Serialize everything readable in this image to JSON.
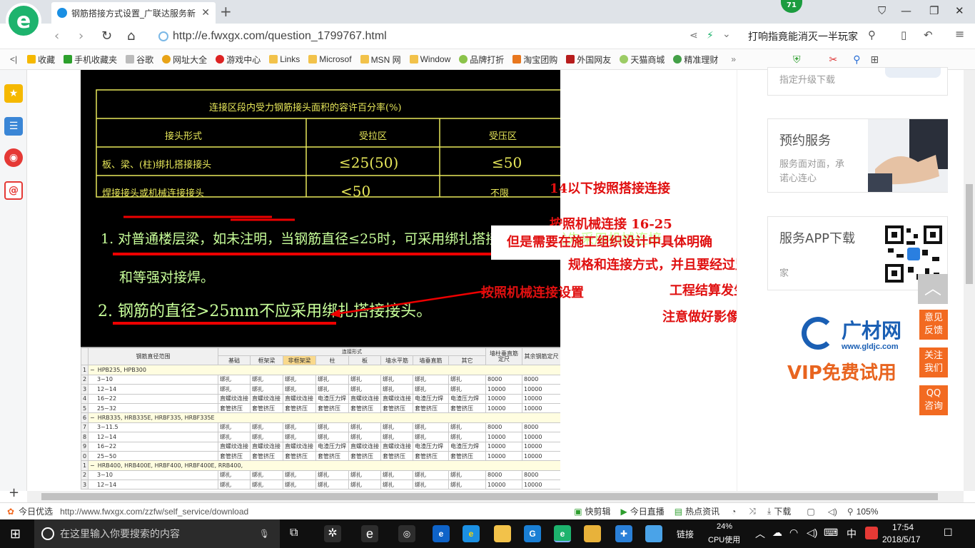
{
  "browser": {
    "tab_title": "钢筋搭接方式设置_广联达服务新",
    "badge": "71",
    "url": "http://e.fwxgx.com/question_1799767.html",
    "search_text": "打响指竟能消灭一半玩家",
    "ie_logo": "e"
  },
  "bookmarks": [
    "收藏",
    "手机收藏夹",
    "谷歌",
    "网址大全",
    "游戏中心",
    "Links",
    "Microsof",
    "MSN 网",
    "Window",
    "品牌打折",
    "淘宝团购",
    "外国网友",
    "天猫商城",
    "精准理财"
  ],
  "cad": {
    "table_title": "连接区段内受力钢筋接头面积的容许百分率(%)",
    "headers": [
      "接头形式",
      "受拉区",
      "受压区"
    ],
    "rows": [
      [
        "板、梁、(柱)绑扎搭接接头",
        "≤25(50)",
        "≤50"
      ],
      [
        "焊接接头或机械连接接头",
        "<50",
        "不限"
      ]
    ],
    "note1a": "1. 对普通楼层梁，如未注明，当钢筋直径≤25时，可采用绑扎搭接，但建议优先采用机械连接",
    "note1b": "和等强对接焊。",
    "note2": "2. 钢筋的直径>25mm不应采用绑扎搭接接头。"
  },
  "annotations": {
    "a1": "14以下按照搭接连接",
    "a2": "按照机械连接 16-25",
    "a3": "但是需要在施工组织设计中具体明确",
    "a4": "规格和连接方式，并且要经过监理签字，避免",
    "a5": "按照机械连接设置",
    "a6": "工程结算发生不必要的麻烦",
    "a7": "注意做好影像资料"
  },
  "sheet": {
    "top_group": "连接形式",
    "headers": [
      "钢筋直径范围",
      "基础",
      "框架梁",
      "非框架梁",
      "柱",
      "板",
      "墙水平筋",
      "墙垂直筋",
      "其它",
      "墙柱垂直筋定尺",
      "其余钢筋定尺"
    ],
    "rows": [
      {
        "n": "1",
        "exp": "−",
        "label": "HPB235, HPB300",
        "cells": [],
        "grp": true
      },
      {
        "n": "2",
        "exp": "",
        "label": "3~10",
        "cells": [
          "绑扎",
          "绑扎",
          "绑扎",
          "绑扎",
          "绑扎",
          "绑扎",
          "绑扎",
          "绑扎",
          "8000",
          "8000"
        ]
      },
      {
        "n": "3",
        "exp": "",
        "label": "12~14",
        "cells": [
          "绑扎",
          "绑扎",
          "绑扎",
          "绑扎",
          "绑扎",
          "绑扎",
          "绑扎",
          "绑扎",
          "10000",
          "10000"
        ]
      },
      {
        "n": "4",
        "exp": "",
        "label": "16~22",
        "cells": [
          "直螺纹连接",
          "直螺纹连接",
          "直螺纹连接",
          "电渣压力焊",
          "直螺纹连接",
          "直螺纹连接",
          "电渣压力焊",
          "电渣压力焊",
          "10000",
          "10000"
        ]
      },
      {
        "n": "5",
        "exp": "",
        "label": "25~32",
        "cells": [
          "套管挤压",
          "套管挤压",
          "套管挤压",
          "套管挤压",
          "套管挤压",
          "套管挤压",
          "套管挤压",
          "套管挤压",
          "10000",
          "10000"
        ]
      },
      {
        "n": "6",
        "exp": "−",
        "label": "HRB335, HRB335E, HRBF335, HRBF335E",
        "cells": [],
        "grp": true
      },
      {
        "n": "7",
        "exp": "",
        "label": "3~11.5",
        "cells": [
          "绑扎",
          "绑扎",
          "绑扎",
          "绑扎",
          "绑扎",
          "绑扎",
          "绑扎",
          "绑扎",
          "8000",
          "8000"
        ]
      },
      {
        "n": "8",
        "exp": "",
        "label": "12~14",
        "cells": [
          "绑扎",
          "绑扎",
          "绑扎",
          "绑扎",
          "绑扎",
          "绑扎",
          "绑扎",
          "绑扎",
          "10000",
          "10000"
        ]
      },
      {
        "n": "9",
        "exp": "",
        "label": "16~22",
        "cells": [
          "直螺纹连接",
          "直螺纹连接",
          "直螺纹连接",
          "电渣压力焊",
          "直螺纹连接",
          "直螺纹连接",
          "电渣压力焊",
          "电渣压力焊",
          "10000",
          "10000"
        ]
      },
      {
        "n": "0",
        "exp": "",
        "label": "25~50",
        "cells": [
          "套管挤压",
          "套管挤压",
          "套管挤压",
          "套管挤压",
          "套管挤压",
          "套管挤压",
          "套管挤压",
          "套管挤压",
          "10000",
          "10000"
        ]
      },
      {
        "n": "1",
        "exp": "−",
        "label": "HRB400, HRB400E, HRBF400, HRBF400E, RRB400,",
        "cells": [],
        "grp": true
      },
      {
        "n": "2",
        "exp": "",
        "label": "3~10",
        "cells": [
          "绑扎",
          "绑扎",
          "绑扎",
          "绑扎",
          "绑扎",
          "绑扎",
          "绑扎",
          "绑扎",
          "8000",
          "8000"
        ]
      },
      {
        "n": "3",
        "exp": "",
        "label": "12~14",
        "cells": [
          "绑扎",
          "绑扎",
          "绑扎",
          "绑扎",
          "绑扎",
          "绑扎",
          "绑扎",
          "绑扎",
          "10000",
          "10000"
        ]
      }
    ]
  },
  "sidebar": {
    "upgrade": "指定升级下载",
    "appoint_title": "预约服务",
    "appoint_desc1": "服务面对面，承",
    "appoint_desc2": "诺心连心",
    "app_title": "服务APP下载",
    "app_desc": "家",
    "brand_logo": "广材网",
    "brand_url": "www.gldjc.com",
    "vip": "VIP免费试用",
    "float1": "意见反馈",
    "float2": "关注我们",
    "float3": "QQ咨询"
  },
  "status": {
    "today": "今日优选",
    "url": "http://www.fwxgx.com/zzfw/self_service/download",
    "kuaijianji": "快剪辑",
    "live": "今日直播",
    "news": "热点资讯",
    "download": "下载",
    "zoom": "105%"
  },
  "taskbar": {
    "search": "在这里输入你要搜索的内容",
    "link": "链接",
    "cpu_pct": "24%",
    "cpu_label": "CPU使用",
    "ime": "中",
    "time": "17:54",
    "date": "2018/5/17"
  }
}
